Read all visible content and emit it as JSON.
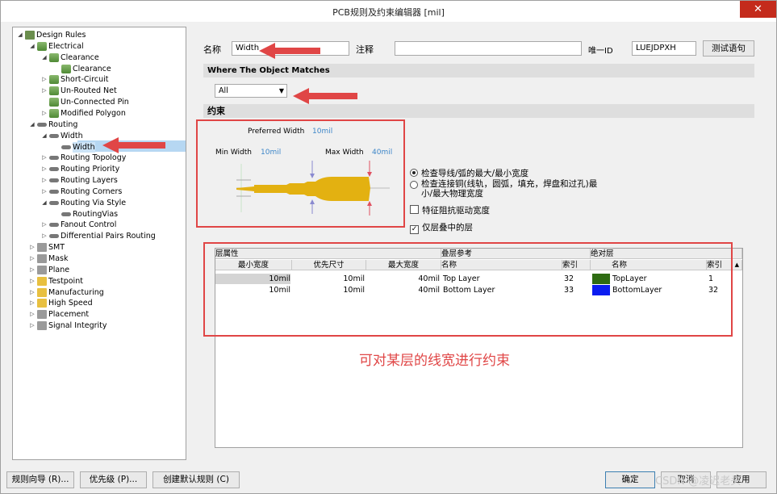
{
  "window": {
    "title": "PCB规则及约束编辑器 [mil]",
    "close": "✕"
  },
  "tree": [
    {
      "label": "Design Rules",
      "arrow": "◢",
      "icon": "folder"
    },
    {
      "label": "Electrical",
      "arrow": "◢",
      "icon": "rule"
    },
    {
      "label": "Clearance",
      "arrow": "◢",
      "icon": "rule"
    },
    {
      "label": "Clearance",
      "arrow": "",
      "icon": "rule"
    },
    {
      "label": "Short-Circuit",
      "arrow": "▷",
      "icon": "rule"
    },
    {
      "label": "Un-Routed Net",
      "arrow": "▷",
      "icon": "rule"
    },
    {
      "label": "Un-Connected Pin",
      "arrow": "",
      "icon": "rule"
    },
    {
      "label": "Modified Polygon",
      "arrow": "▷",
      "icon": "rule"
    },
    {
      "label": "Routing",
      "arrow": "◢",
      "icon": "route"
    },
    {
      "label": "Width",
      "arrow": "◢",
      "icon": "route"
    },
    {
      "label": "Width",
      "arrow": "",
      "icon": "route"
    },
    {
      "label": "Routing Topology",
      "arrow": "▷",
      "icon": "route"
    },
    {
      "label": "Routing Priority",
      "arrow": "▷",
      "icon": "route"
    },
    {
      "label": "Routing Layers",
      "arrow": "▷",
      "icon": "route"
    },
    {
      "label": "Routing Corners",
      "arrow": "▷",
      "icon": "route"
    },
    {
      "label": "Routing Via Style",
      "arrow": "◢",
      "icon": "route"
    },
    {
      "label": "RoutingVias",
      "arrow": "",
      "icon": "route"
    },
    {
      "label": "Fanout Control",
      "arrow": "▷",
      "icon": "route"
    },
    {
      "label": "Differential Pairs Routing",
      "arrow": "▷",
      "icon": "route"
    },
    {
      "label": "SMT",
      "arrow": "▷",
      "icon": "grey"
    },
    {
      "label": "Mask",
      "arrow": "▷",
      "icon": "grey"
    },
    {
      "label": "Plane",
      "arrow": "▷",
      "icon": "grey"
    },
    {
      "label": "Testpoint",
      "arrow": "▷",
      "icon": "yellow"
    },
    {
      "label": "Manufacturing",
      "arrow": "▷",
      "icon": "yellow"
    },
    {
      "label": "High Speed",
      "arrow": "▷",
      "icon": "yellow"
    },
    {
      "label": "Placement",
      "arrow": "▷",
      "icon": "grey"
    },
    {
      "label": "Signal Integrity",
      "arrow": "▷",
      "icon": "grey"
    }
  ],
  "form": {
    "name_label": "名称",
    "name_value": "Width",
    "comment_label": "注释",
    "comment_value": "",
    "uid_label": "唯一ID",
    "uid_value": "LUEJDPXH",
    "test_button": "测试语句"
  },
  "match": {
    "header": "Where The Object Matches",
    "selected": "All",
    "arrow": "▼"
  },
  "constraints": {
    "header": "约束",
    "preferred_label": "Preferred Width",
    "preferred_value": "10mil",
    "min_label": "Min Width",
    "min_value": "10mil",
    "max_label": "Max Width",
    "max_value": "40mil",
    "radio1": "检查导线/弧的最大/最小宽度",
    "radio2_line1": "检查连接铜(线轨，圆弧，填充，焊盘和过孔)最",
    "radio2_line2": "小/最大物理宽度",
    "check1": "特征阻抗驱动宽度",
    "check2": "仅层叠中的层",
    "check2_mark": "✓"
  },
  "table": {
    "group1": "层属性",
    "group2": "叠层参考",
    "group3": "绝对层",
    "col_min": "最小宽度",
    "col_pref": "优先尺寸",
    "col_max": "最大宽度",
    "col_name": "名称",
    "col_index": "索引",
    "col_name2": "名称",
    "col_index2": "索引",
    "sort_arrow": "▲",
    "rows": [
      {
        "min": "10mil",
        "pref": "10mil",
        "max": "40mil",
        "name": "Top Layer",
        "index": "32",
        "color": "#2e6b12",
        "abs_name": "TopLayer",
        "abs_index": "1"
      },
      {
        "min": "10mil",
        "pref": "10mil",
        "max": "40mil",
        "name": "Bottom Layer",
        "index": "33",
        "color": "#0a1cf0",
        "abs_name": "BottomLayer",
        "abs_index": "32"
      }
    ]
  },
  "annotation": "可对某层的线宽进行约束",
  "buttons": {
    "wizard": "规则向导 (R)...",
    "priority": "优先级 (P)...",
    "defaults": "创建默认规则 (C)",
    "ok": "确定",
    "cancel": "取消",
    "apply": "应用"
  },
  "watermark": "CSDN @凌迟老头"
}
